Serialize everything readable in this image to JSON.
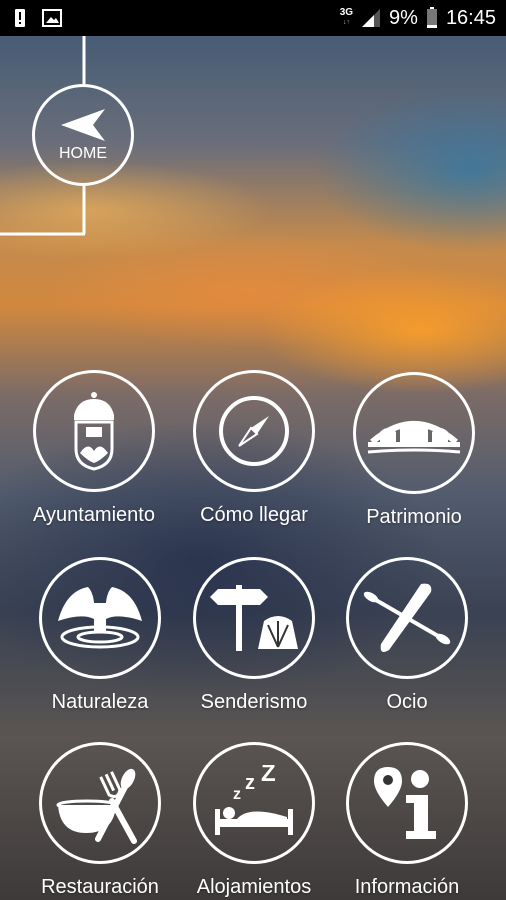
{
  "status_bar": {
    "network": "3G",
    "battery_percent": "9%",
    "time": "16:45",
    "icons": [
      "alert-icon",
      "image-icon",
      "signal-icon",
      "battery-icon"
    ]
  },
  "home": {
    "label": "HOME",
    "icon": "arrow-left-icon"
  },
  "menu": [
    {
      "label": "Ayuntamiento",
      "icon": "coat-of-arms-icon"
    },
    {
      "label": "Cómo llegar",
      "icon": "compass-icon"
    },
    {
      "label": "Patrimonio",
      "icon": "arches-building-icon"
    },
    {
      "label": "Naturaleza",
      "icon": "waterfall-icon"
    },
    {
      "label": "Senderismo",
      "icon": "signpost-shell-icon"
    },
    {
      "label": "Ocio",
      "icon": "kayak-icon"
    },
    {
      "label": "Restauración",
      "icon": "bowl-utensils-icon"
    },
    {
      "label": "Alojamientos",
      "icon": "bed-icon"
    },
    {
      "label": "Información",
      "icon": "info-location-icon"
    }
  ],
  "colors": {
    "icon_stroke": "#ffffff",
    "status_bar_bg": "#000000"
  }
}
